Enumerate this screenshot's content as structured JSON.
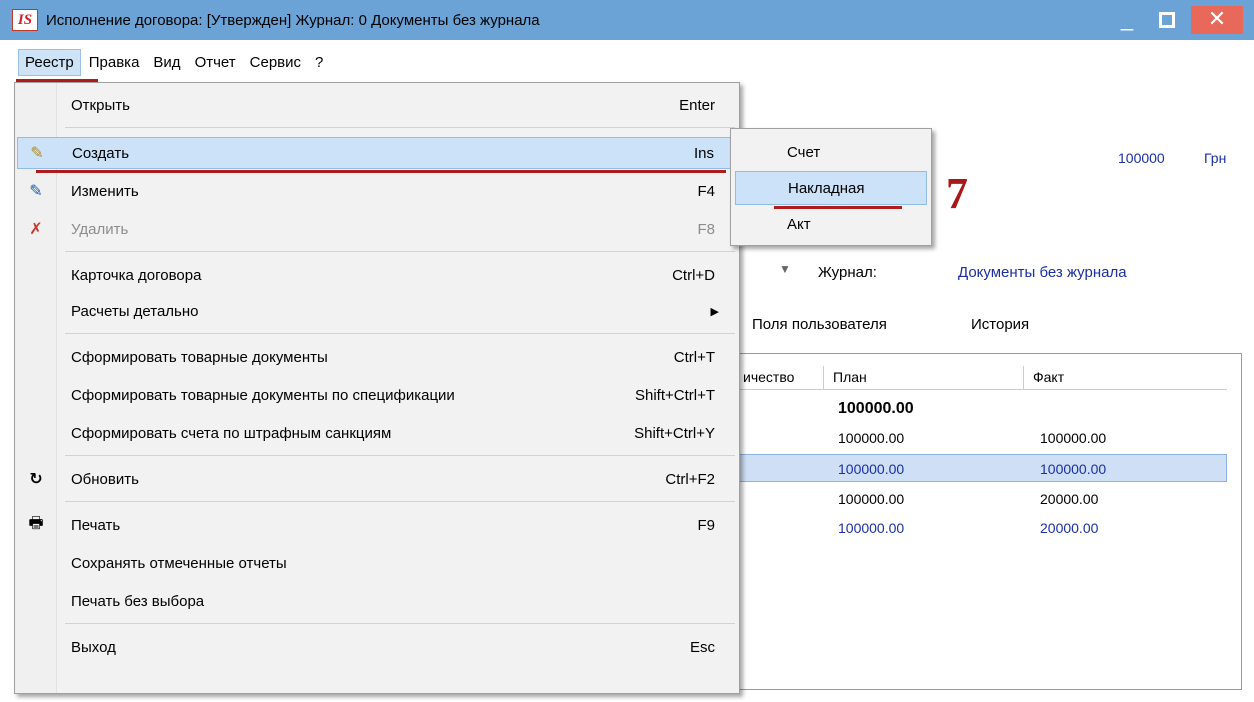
{
  "window": {
    "logo": "IS",
    "title": "Исполнение договора:  [Утвержден] Журнал: 0 Документы без журнала"
  },
  "menubar": [
    "Реестр",
    "Правка",
    "Вид",
    "Отчет",
    "Сервис",
    "?"
  ],
  "dropdown": {
    "items": [
      {
        "label": "Открыть",
        "shortcut": "Enter"
      },
      {
        "label": "Создать",
        "shortcut": "Ins"
      },
      {
        "label": "Изменить",
        "shortcut": "F4"
      },
      {
        "label": "Удалить",
        "shortcut": "F8"
      },
      {
        "label": "Карточка договора",
        "shortcut": "Ctrl+D"
      },
      {
        "label": "Расчеты детально",
        "shortcut": ""
      },
      {
        "label": "Сформировать товарные документы",
        "shortcut": "Ctrl+T"
      },
      {
        "label": "Сформировать товарные документы по спецификации",
        "shortcut": "Shift+Ctrl+T"
      },
      {
        "label": "Сформировать счета по штрафным санкциям",
        "shortcut": "Shift+Ctrl+Y"
      },
      {
        "label": "Обновить",
        "shortcut": "Ctrl+F2"
      },
      {
        "label": "Печать",
        "shortcut": "F9"
      },
      {
        "label": "Сохранять отмеченные отчеты",
        "shortcut": ""
      },
      {
        "label": "Печать без выбора",
        "shortcut": ""
      },
      {
        "label": "Выход",
        "shortcut": "Esc"
      }
    ]
  },
  "submenu": [
    "Счет",
    "Накладная",
    "Акт"
  ],
  "step_marker": "7",
  "background": {
    "amount": "100000",
    "currency": "Грн",
    "journal_label": "Журнал:",
    "journal_value": "Документы без журнала",
    "tabs": [
      "Поля пользователя",
      "История"
    ],
    "table": {
      "headers": [
        "ичество",
        "План",
        "Факт"
      ],
      "total": "100000.00",
      "rows": [
        {
          "plan": "100000.00",
          "fact": "100000.00",
          "color": "#000000"
        },
        {
          "plan": "100000.00",
          "fact": "100000.00",
          "color": "#1a2fa0"
        },
        {
          "plan": "100000.00",
          "fact": "20000.00",
          "color": "#000000"
        },
        {
          "plan": "100000.00",
          "fact": "20000.00",
          "color": "#1a2fa0"
        }
      ]
    }
  },
  "colors": {
    "title_bar": "#6ba3d6",
    "highlight": "#cce2f8",
    "annotation": "#b01c1c",
    "link_blue": "#1a2fa0"
  }
}
